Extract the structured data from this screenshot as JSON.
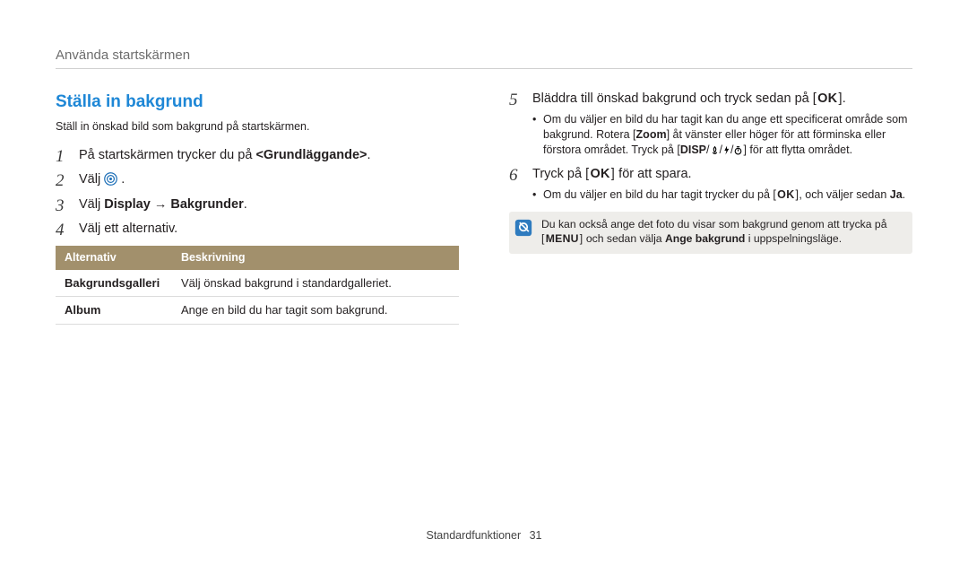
{
  "breadcrumb": "Använda startskärmen",
  "section_title": "Ställa in bakgrund",
  "lead": "Ställ in önskad bild som bakgrund på startskärmen.",
  "steps_left": {
    "s1_pre": "På startskärmen trycker du på ",
    "s1_bold": "<Grundläggande>",
    "s1_post": ".",
    "s2_pre": "Välj ",
    "s2_post": ".",
    "s3_pre": "Välj ",
    "s3_bold": "Display → Bakgrunder",
    "s3_post": ".",
    "s4": "Välj ett alternativ."
  },
  "table": {
    "head_option": "Alternativ",
    "head_desc": "Beskrivning",
    "rows": [
      {
        "k": "Bakgrundsgalleri",
        "v": "Välj önskad bakgrund i standardgalleriet."
      },
      {
        "k": "Album",
        "v": "Ange en bild du har tagit som bakgrund."
      }
    ]
  },
  "step5": {
    "num": "5",
    "text_pre": "Bläddra till önskad bakgrund och tryck sedan på ",
    "ok": "OK",
    "text_post": ".",
    "bullet_pre": "Om du väljer en bild du har tagit kan du ange ett specificerat område som bakgrund. Rotera [",
    "bullet_zoom": "Zoom",
    "bullet_mid": "] åt vänster eller höger för att förminska eller förstora området. Tryck på ",
    "disp": "DISP",
    "bullet_nav_mid": "/",
    "bullet_nav_end": "] för att flytta området."
  },
  "step6": {
    "num": "6",
    "text_pre": "Tryck på ",
    "ok": "OK",
    "text_post": " för att spara.",
    "bullet_pre": "Om du väljer en bild du har tagit trycker du på ",
    "bullet_mid": ", och väljer sedan ",
    "bullet_ja": "Ja",
    "bullet_post": "."
  },
  "note": {
    "line1_pre": "Du kan också ange det foto du visar som bakgrund genom att trycka på ",
    "menu": "MENU",
    "line2_pre": "och sedan välja ",
    "line2_bold": "Ange bakgrund",
    "line2_post": " i uppspelningsläge."
  },
  "footer_label": "Standardfunktioner",
  "footer_page": "31",
  "nums": {
    "n1": "1",
    "n2": "2",
    "n3": "3",
    "n4": "4"
  }
}
